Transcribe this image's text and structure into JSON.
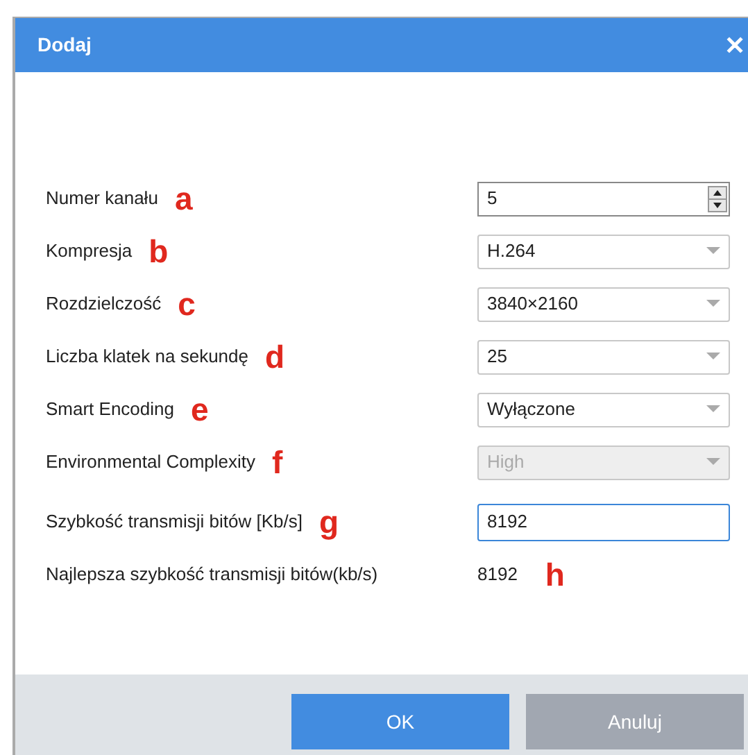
{
  "window": {
    "title": "Dodaj",
    "close": "✕"
  },
  "fields": [
    {
      "label": "Numer kanału",
      "annotation": "a",
      "kind": "spin",
      "value": "5",
      "disabled": false,
      "focused": false
    },
    {
      "label": "Kompresja",
      "annotation": "b",
      "kind": "select",
      "value": "H.264",
      "disabled": false,
      "focused": false
    },
    {
      "label": "Rozdzielczość",
      "annotation": "c",
      "kind": "select",
      "value": "3840×2160",
      "disabled": false,
      "focused": false
    },
    {
      "label": "Liczba klatek na sekundę",
      "annotation": "d",
      "kind": "select",
      "value": "25",
      "disabled": false,
      "focused": false
    },
    {
      "label": "Smart Encoding",
      "annotation": "e",
      "kind": "select",
      "value": "Wyłączone",
      "disabled": false,
      "focused": false
    },
    {
      "label": "Environmental Complexity",
      "annotation": "f",
      "kind": "select",
      "value": "High",
      "disabled": true,
      "focused": false
    },
    {
      "label": "Szybkość transmisji bitów [Kb/s]",
      "annotation": "g",
      "kind": "text",
      "value": "8192",
      "disabled": false,
      "focused": true
    },
    {
      "label": "Najlepsza szybkość transmisji bitów(kb/s)",
      "annotation": "h",
      "kind": "readout",
      "value": "8192"
    }
  ],
  "buttons": [
    {
      "label": "OK",
      "kind": "primary"
    },
    {
      "label": "Anuluj",
      "kind": "secondary"
    }
  ]
}
